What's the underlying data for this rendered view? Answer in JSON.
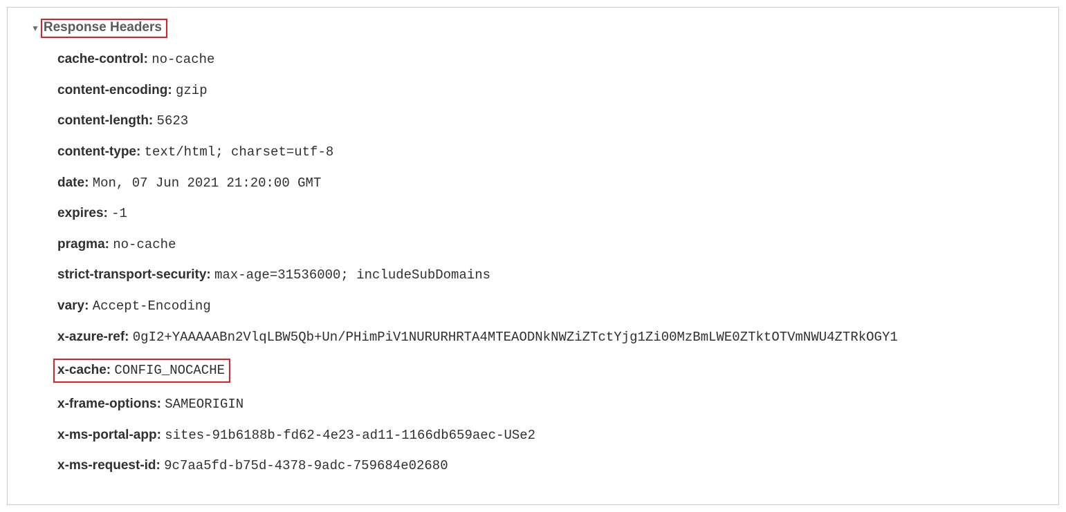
{
  "section": {
    "title": "Response Headers"
  },
  "headers": [
    {
      "name": "cache-control:",
      "value": "no-cache",
      "highlight": false
    },
    {
      "name": "content-encoding:",
      "value": "gzip",
      "highlight": false
    },
    {
      "name": "content-length:",
      "value": "5623",
      "highlight": false
    },
    {
      "name": "content-type:",
      "value": "text/html; charset=utf-8",
      "highlight": false
    },
    {
      "name": "date:",
      "value": "Mon, 07 Jun 2021 21:20:00 GMT",
      "highlight": false
    },
    {
      "name": "expires:",
      "value": "-1",
      "highlight": false
    },
    {
      "name": "pragma:",
      "value": "no-cache",
      "highlight": false
    },
    {
      "name": "strict-transport-security:",
      "value": "max-age=31536000; includeSubDomains",
      "highlight": false
    },
    {
      "name": "vary:",
      "value": "Accept-Encoding",
      "highlight": false
    },
    {
      "name": "x-azure-ref:",
      "value": "0gI2+YAAAAABn2VlqLBW5Qb+Un/PHimPiV1NURURHRTA4MTEAODNkNWZiZTctYjg1Zi00MzBmLWE0ZTktOTVmNWU4ZTRkOGY1",
      "highlight": false
    },
    {
      "name": "x-cache:",
      "value": "CONFIG_NOCACHE",
      "highlight": true
    },
    {
      "name": "x-frame-options:",
      "value": "SAMEORIGIN",
      "highlight": false
    },
    {
      "name": "x-ms-portal-app:",
      "value": "sites-91b6188b-fd62-4e23-ad11-1166db659aec-USe2",
      "highlight": false
    },
    {
      "name": "x-ms-request-id:",
      "value": "9c7aa5fd-b75d-4378-9adc-759684e02680",
      "highlight": false
    }
  ]
}
